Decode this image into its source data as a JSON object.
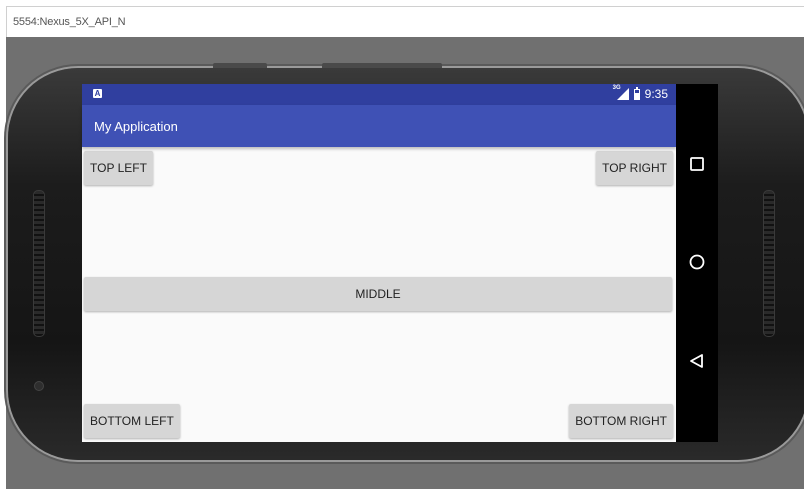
{
  "window": {
    "title": "5554:Nexus_5X_API_N"
  },
  "statusbar": {
    "network_type": "3G",
    "time": "9:35",
    "app_icon_letter": "A"
  },
  "app": {
    "title": "My Application"
  },
  "buttons": {
    "top_left": "TOP LEFT",
    "top_right": "TOP RIGHT",
    "middle": "MIDDLE",
    "bottom_left": "BOTTOM LEFT",
    "bottom_right": "BOTTOM RIGHT"
  },
  "navbar": {
    "items": [
      "square-recents-icon",
      "circle-home-icon",
      "triangle-back-icon"
    ]
  },
  "colors": {
    "status_bar": "#303f9f",
    "app_bar": "#3f51b5",
    "content_bg": "#fafafa",
    "button_bg": "#d6d6d6",
    "emulator_frame": "#707070"
  }
}
